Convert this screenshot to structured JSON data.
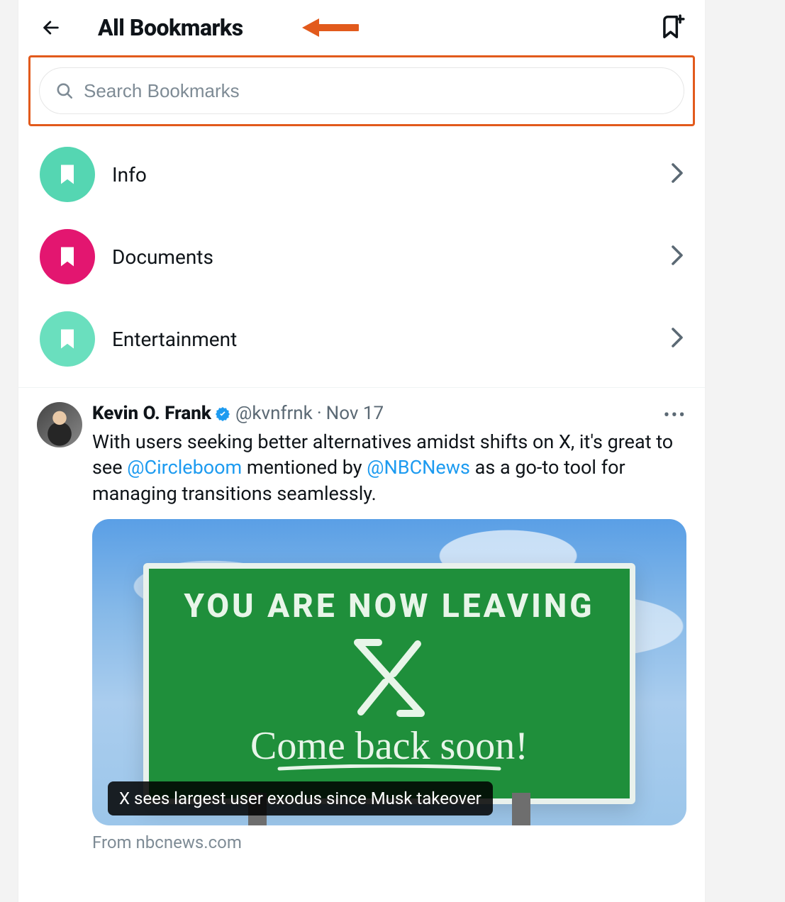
{
  "header": {
    "title": "All Bookmarks"
  },
  "search": {
    "placeholder": "Search Bookmarks"
  },
  "folders": [
    {
      "label": "Info",
      "color": "#55d6b2"
    },
    {
      "label": "Documents",
      "color": "#e31670"
    },
    {
      "label": "Entertainment",
      "color": "#6adfbe"
    }
  ],
  "tweet": {
    "display_name": "Kevin O. Frank",
    "handle": "@kvnfrnk",
    "date": "Nov 17",
    "text_pre": "With users seeking better alternatives amidst shifts on X, it's great to see ",
    "mention1": "@Circleboom",
    "text_mid": " mentioned by ",
    "mention2": "@NBCNews",
    "text_post": " as a go-to tool for managing transitions seamlessly.",
    "card": {
      "sign_line1": "YOU ARE NOW LEAVING",
      "sign_line2": "Come back soon!",
      "banner": "X sees largest user exodus since Musk takeover"
    },
    "source": "From nbcnews.com"
  },
  "annotation": {
    "highlight_color": "#e25a1c"
  }
}
